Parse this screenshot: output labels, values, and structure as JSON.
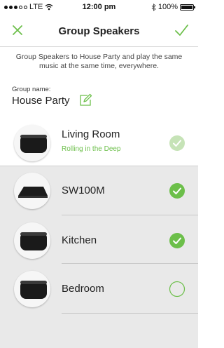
{
  "status_bar": {
    "carrier": "LTE",
    "time": "12:00 pm",
    "battery": "100%",
    "battery_level": 1.0
  },
  "nav": {
    "title": "Group Speakers"
  },
  "description": "Group Speakers to House Party and play the same music at the same time, everywhere.",
  "group": {
    "label": "Group name:",
    "name": "House Party"
  },
  "speakers": [
    {
      "name": "Living Room",
      "subtitle": "Rolling in the Deep",
      "state": "selected-disabled"
    },
    {
      "name": "SW100M",
      "subtitle": "",
      "state": "selected"
    },
    {
      "name": "Kitchen",
      "subtitle": "",
      "state": "selected"
    },
    {
      "name": "Bedroom",
      "subtitle": "",
      "state": "unselected"
    }
  ],
  "colors": {
    "accent": "#6cbf4a",
    "accent_light": "#c6e3b7",
    "list_bg": "#e9e9e9"
  }
}
